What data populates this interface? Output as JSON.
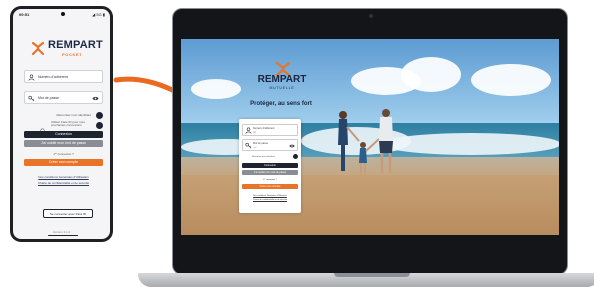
{
  "colors": {
    "navy": "#1e2330",
    "orange": "#e8742a",
    "grey_button": "#8a8d93"
  },
  "phone": {
    "status": {
      "time": "09:51",
      "icons": "◢ 5G ▮"
    },
    "logo": {
      "brand": "REMPART",
      "sub": "POCKET",
      "icon": "rempart-logo"
    },
    "fields": [
      {
        "label": "Numéro d'adhérent",
        "icon": "person-icon"
      },
      {
        "label": "Mot de passe",
        "icon": "key-icon",
        "trailing_icon": "eye-icon"
      }
    ],
    "toggles": [
      {
        "label": "Mémoriser mon identifiant"
      },
      {
        "label": "Utiliser Face ID pour mes prochaines connexions"
      }
    ],
    "connect_button": "Connexion",
    "forgot_button": "J'ai oublié mon mot de passe",
    "first_connection": "1ʳᵉ connexion ?",
    "create_button": "Créer mon compte",
    "legal_links": [
      "Nos conditions Générales d'Utilisation",
      "Charte de confidentialité et de sécurité"
    ],
    "pass_button": "Se connecter avec Pass ID",
    "version": "Version 3.1.0"
  },
  "web": {
    "brand": "REMPART",
    "sub": "MUTUELLE",
    "tagline": "Protéger, au sens fort",
    "fields": [
      {
        "label": "Numéro d'adhérent",
        "value": "00",
        "icon": "person-icon"
      },
      {
        "label": "Mot de passe",
        "value": "••••",
        "icon": "key-icon",
        "trailing_icon": "eye-icon"
      }
    ],
    "remember_label": "Mémoriser mon identifiant",
    "connect_button": "Connexion",
    "forgot_button": "J'ai oublié mon mot de passe",
    "first_connection": "1ʳᵉ connexion ?",
    "create_button": "Créer mon compte",
    "legal_links": [
      "Nos conditions Générales d'Utilisation",
      "Charte de confidentialité et de sécurité"
    ]
  }
}
